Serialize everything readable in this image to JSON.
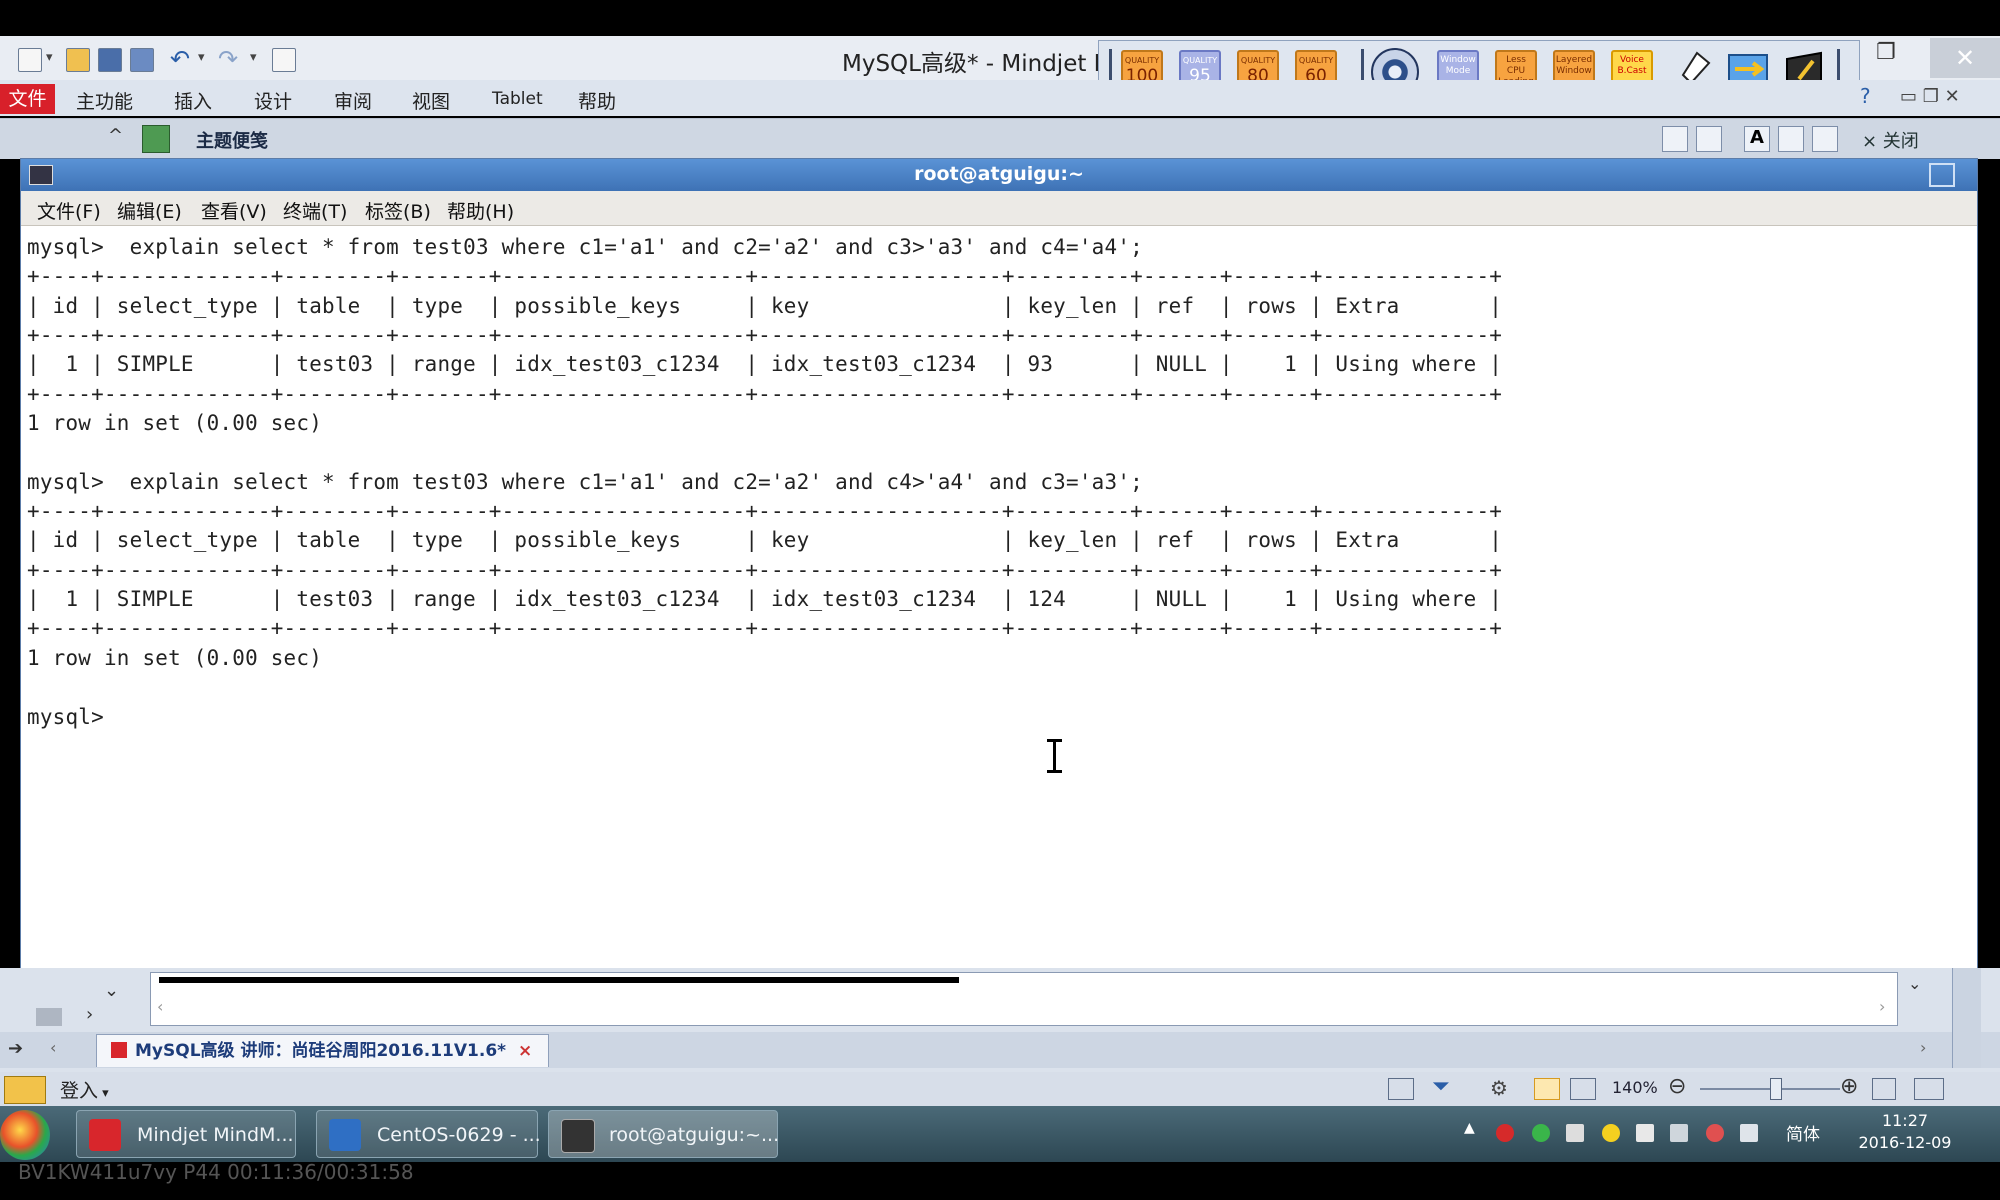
{
  "app_title": "MySQL高级* - Mindjet M",
  "ribbon": {
    "file_tab": "文件",
    "tabs": [
      "主功能",
      "插入",
      "设计",
      "审阅",
      "视图",
      "Tablet",
      "帮助"
    ]
  },
  "quality_toolbar": {
    "buttons": [
      {
        "top": "QUALITY",
        "value": "100"
      },
      {
        "top": "QUALITY",
        "value": "95"
      },
      {
        "top": "QUALITY",
        "value": "80"
      },
      {
        "top": "QUALITY",
        "value": "60"
      }
    ],
    "window_mode": "Window Mode",
    "less_cpu": "Less CPU Loading",
    "layered": "Layered Window",
    "voice": "Voice B.Cast"
  },
  "note_strip": {
    "label": "主题便笺",
    "close_label": "× 关闭"
  },
  "terminal": {
    "title": "root@atguigu:~",
    "menu": [
      "文件(F)",
      "编辑(E)",
      "查看(V)",
      "终端(T)",
      "标签(B)",
      "帮助(H)"
    ],
    "lines": [
      "mysql>  explain select * from test03 where c1='a1' and c2='a2' and c3>'a3' and c4='a4';",
      "+----+-------------+--------+-------+-------------------+-------------------+---------+------+------+-------------+",
      "| id | select_type | table  | type  | possible_keys     | key               | key_len | ref  | rows | Extra       |",
      "+----+-------------+--------+-------+-------------------+-------------------+---------+------+------+-------------+",
      "|  1 | SIMPLE      | test03 | range | idx_test03_c1234  | idx_test03_c1234  | 93      | NULL |    1 | Using where |",
      "+----+-------------+--------+-------+-------------------+-------------------+---------+------+------+-------------+",
      "1 row in set (0.00 sec)",
      "",
      "mysql>  explain select * from test03 where c1='a1' and c2='a2' and c4>'a4' and c3='a3';",
      "+----+-------------+--------+-------+-------------------+-------------------+---------+------+------+-------------+",
      "| id | select_type | table  | type  | possible_keys     | key               | key_len | ref  | rows | Extra       |",
      "+----+-------------+--------+-------+-------------------+-------------------+---------+------+------+-------------+",
      "|  1 | SIMPLE      | test03 | range | idx_test03_c1234  | idx_test03_c1234  | 124     | NULL |    1 | Using where |",
      "+----+-------------+--------+-------+-------------------+-------------------+---------+------+------+-------------+",
      "1 row in set (0.00 sec)",
      "",
      "mysql> "
    ]
  },
  "doc_tab": {
    "label": "MySQL高级 讲师：尚硅谷周阳2016.11V1.6*",
    "close": "×"
  },
  "status_bar": {
    "login": "登入",
    "zoom": "140%"
  },
  "taskbar": {
    "buttons": [
      {
        "label": "Mindjet MindM...",
        "color": "#d8262c"
      },
      {
        "label": "CentOS-0629 - ...",
        "color": "#2f6fc4"
      },
      {
        "label": "root@atguigu:~...",
        "color": "#333333"
      }
    ],
    "ime": "简体",
    "time": "11:27",
    "date": "2016-12-09"
  },
  "watermark": "BV1KW411u7vy P44 00:11:36/00:31:58",
  "colors": {
    "file_tab": "#d8202a",
    "terminal_title": "#3e72b5",
    "taskbar": "#2d4753"
  }
}
